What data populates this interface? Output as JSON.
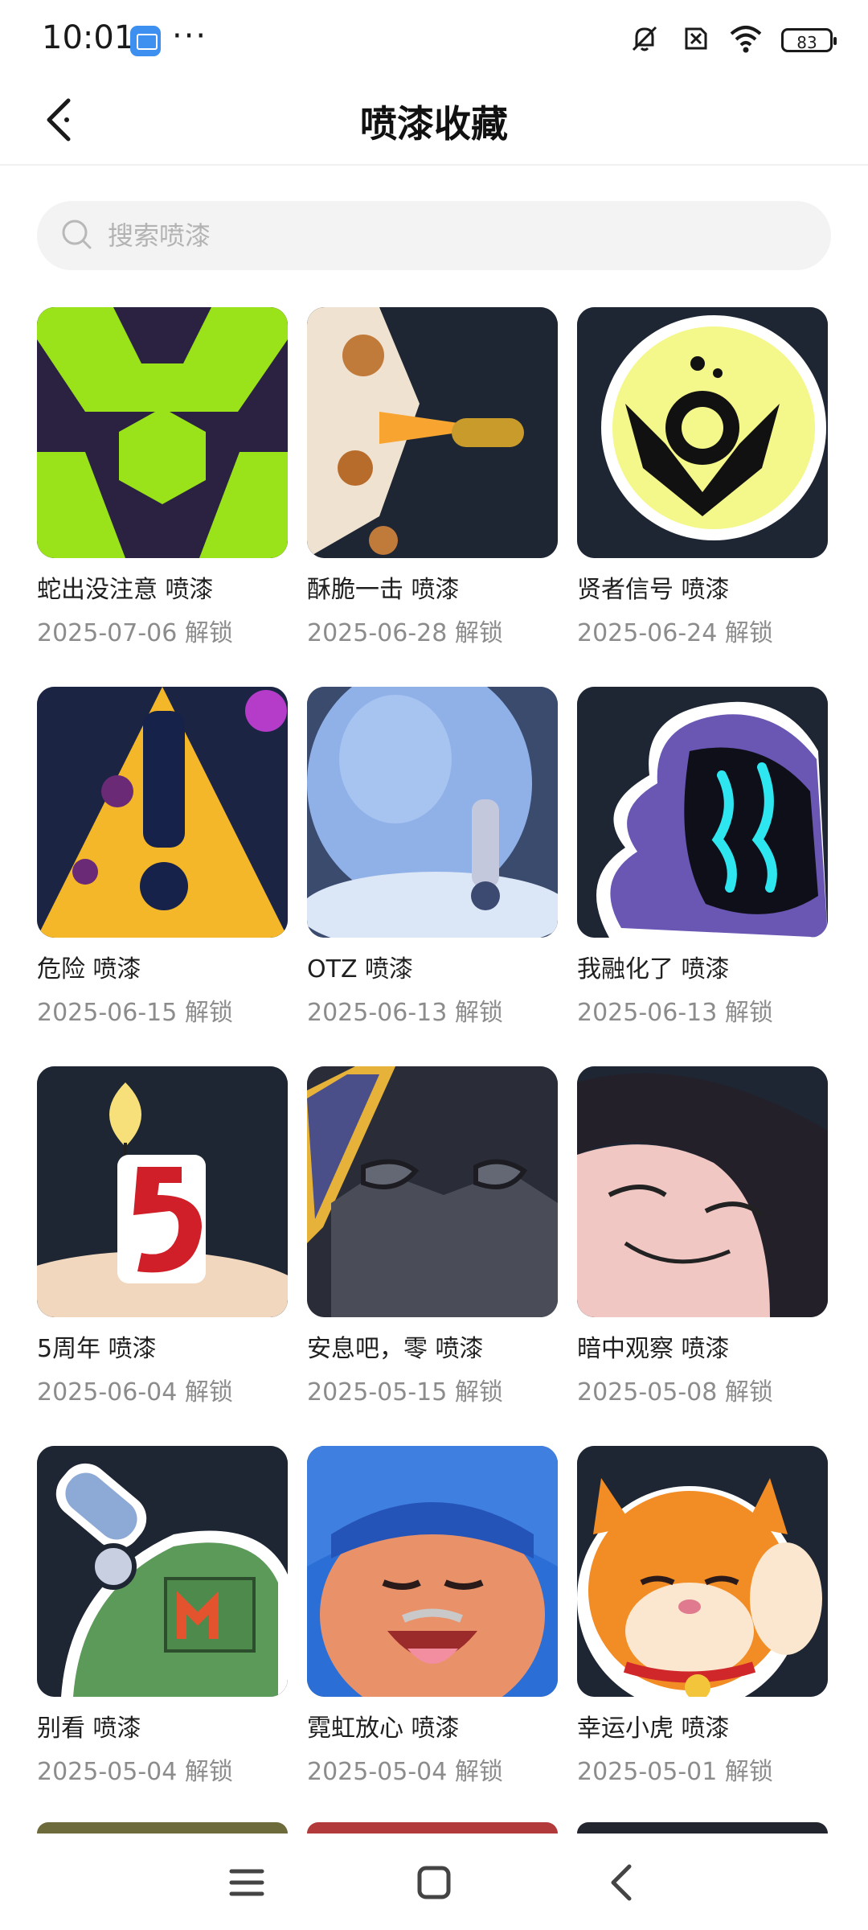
{
  "status_bar": {
    "time": "10:01",
    "more": "···",
    "battery": "83"
  },
  "header": {
    "title": "喷漆收藏"
  },
  "search": {
    "placeholder": "搜索喷漆"
  },
  "items": [
    {
      "name": "蛇出没注意 喷漆",
      "date": "2025-07-06 解锁"
    },
    {
      "name": "酥脆一击 喷漆",
      "date": "2025-06-28 解锁"
    },
    {
      "name": "贤者信号 喷漆",
      "date": "2025-06-24 解锁"
    },
    {
      "name": "危险 喷漆",
      "date": "2025-06-15 解锁"
    },
    {
      "name": "OTZ 喷漆",
      "date": "2025-06-13 解锁"
    },
    {
      "name": "我融化了 喷漆",
      "date": "2025-06-13 解锁"
    },
    {
      "name": "5周年 喷漆",
      "date": "2025-06-04 解锁"
    },
    {
      "name": "安息吧，零 喷漆",
      "date": "2025-05-15 解锁"
    },
    {
      "name": "暗中观察 喷漆",
      "date": "2025-05-08 解锁"
    },
    {
      "name": "别看 喷漆",
      "date": "2025-05-04 解锁"
    },
    {
      "name": "霓虹放心 喷漆",
      "date": "2025-05-04 解锁"
    },
    {
      "name": "幸运小虎 喷漆",
      "date": "2025-05-01 解锁"
    }
  ]
}
